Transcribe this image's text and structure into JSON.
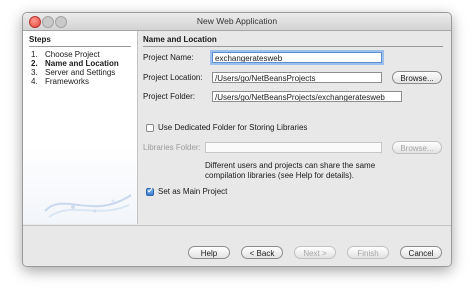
{
  "window": {
    "title": "New Web Application"
  },
  "steps": {
    "header": "Steps",
    "items": [
      {
        "num": "1.",
        "label": "Choose Project",
        "current": false
      },
      {
        "num": "2.",
        "label": "Name and Location",
        "current": true
      },
      {
        "num": "3.",
        "label": "Server and Settings",
        "current": false
      },
      {
        "num": "4.",
        "label": "Frameworks",
        "current": false
      }
    ]
  },
  "form": {
    "section_title": "Name and Location",
    "project_name": {
      "label": "Project Name:",
      "value": "exchangeratesweb"
    },
    "project_location": {
      "label": "Project Location:",
      "value": "/Users/go/NetBeansProjects",
      "browse_label": "Browse..."
    },
    "project_folder": {
      "label": "Project Folder:",
      "value": "/Users/go/NetBeansProjects/exchangeratesweb"
    },
    "dedicated_folder": {
      "label": "Use Dedicated Folder for Storing Libraries",
      "checked": false
    },
    "libraries_folder": {
      "label": "Libraries Folder:",
      "value": "",
      "browse_label": "Browse..."
    },
    "libraries_help": "Different users and projects can share the same compilation libraries (see Help for details).",
    "main_project": {
      "label": "Set as Main Project",
      "checked": true
    }
  },
  "footer": {
    "help": "Help",
    "back": "< Back",
    "next": "Next >",
    "finish": "Finish",
    "cancel": "Cancel"
  }
}
